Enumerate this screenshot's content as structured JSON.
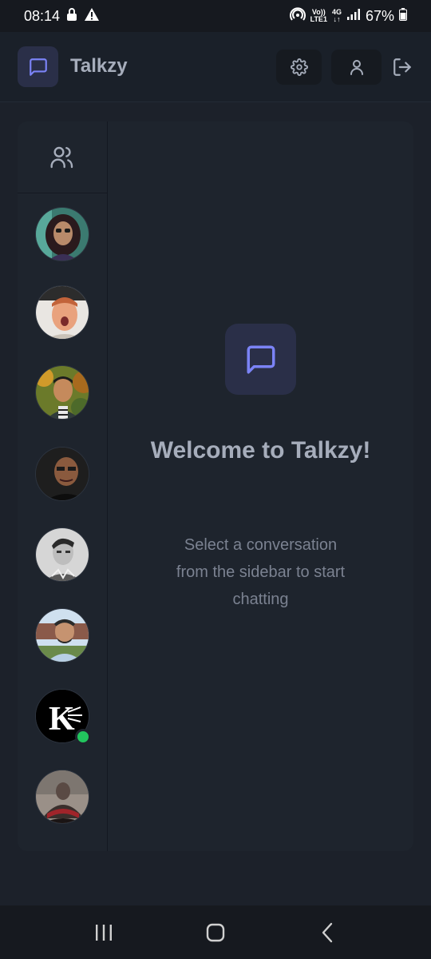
{
  "status": {
    "time": "08:14",
    "volte_top": "Vo))",
    "volte_bottom": "LTE1",
    "network_type": "4G",
    "battery": "67%"
  },
  "header": {
    "app_title": "Talkzy",
    "logo_icon": "message-square-icon",
    "settings_icon": "gear-icon",
    "profile_icon": "user-icon",
    "logout_icon": "logout-icon"
  },
  "sidebar": {
    "header_icon": "users-icon",
    "contacts": [
      {
        "avatar": "photo",
        "online": false
      },
      {
        "avatar": "photo",
        "online": false
      },
      {
        "avatar": "photo",
        "online": false
      },
      {
        "avatar": "photo",
        "online": false
      },
      {
        "avatar": "photo",
        "online": false
      },
      {
        "avatar": "photo",
        "online": false
      },
      {
        "avatar": "K logo",
        "online": true
      },
      {
        "avatar": "photo",
        "online": false
      }
    ]
  },
  "main": {
    "welcome_title": "Welcome to Talkzy!",
    "welcome_subtitle": "Select a conversation from the sidebar to start chatting"
  },
  "colors": {
    "accent": "#7b83f6",
    "background": "#1c212a",
    "online": "#22c55e"
  }
}
